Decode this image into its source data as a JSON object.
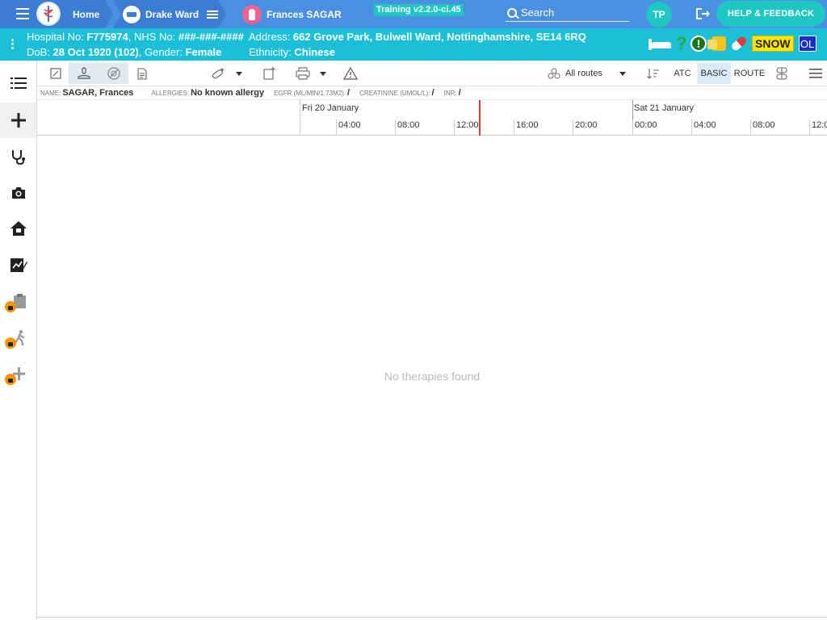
{
  "nav": {
    "home": "Home",
    "ward": "Drake Ward",
    "patient": "Frances SAGAR",
    "training": "Training v2.2.0-ci.45",
    "search_placeholder": "Search",
    "avatar": "TP",
    "help": "HELP & FEEDBACK"
  },
  "banner": {
    "hospital_label": "Hospital No: ",
    "hospital_value": "F775974",
    "nhs_label": ", NHS No: ",
    "nhs_value": "###-###-####",
    "dob_label": "DoB: ",
    "dob_value": "28 Oct 1920 (102)",
    "gender_label": ", Gender: ",
    "gender_value": "Female",
    "address_label": "Address: ",
    "address_value": "662 Grove Park, Bulwell Ward, Nottinghamshire, SE14 6RQ",
    "ethnicity_label": "Ethnicity: ",
    "ethnicity_value": "Chinese",
    "snow": "SNOW",
    "ol": "OL",
    "question": "?",
    "alert": "!"
  },
  "sidebar": {
    "icons": [
      "list-icon",
      "add-icon",
      "stethoscope-icon",
      "camera-icon",
      "home-icon",
      "chart-edit-icon",
      "clipboard-locked-icon",
      "walk-locked-icon",
      "add-locked-icon"
    ]
  },
  "toolbar": {
    "routes": "All routes",
    "atc": "ATC",
    "basic": "BASIC",
    "route": "ROUTE"
  },
  "info": {
    "name_label": "NAME:",
    "name_value": "SAGAR, Frances",
    "allergies_label": "ALLERGIES:",
    "allergies_value": "No known allergy",
    "egfr_label": "EGFR (ML/MIN/1.73M2):",
    "egfr_value": "/",
    "creatinine_label": "CREATININE (UMOL/L):",
    "creatinine_value": "/",
    "inr_label": "INR:",
    "inr_value": "/"
  },
  "timeline": {
    "day1": "Fri 20 January",
    "day2": "Sat 21 January",
    "ticks": [
      "04:00",
      "08:00",
      "12:00",
      "16:00",
      "20:00",
      "00:00",
      "04:00",
      "08:00",
      "12:0"
    ]
  },
  "empty_message": "No therapies found",
  "colors": {
    "nav": "#4a90e0",
    "banner": "#1cbfd8",
    "accent": "#1ec7c4",
    "now_line": "#e53935"
  }
}
